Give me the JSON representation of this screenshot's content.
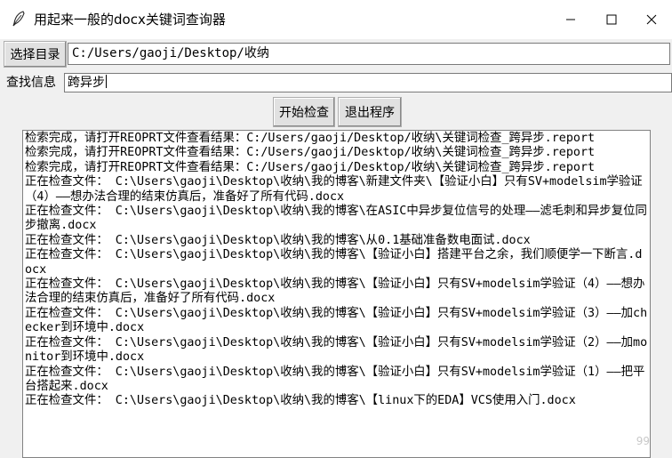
{
  "window": {
    "title": "用起来一般的docx关键词查询器",
    "minimize_icon": "minimize-icon",
    "maximize_icon": "maximize-icon",
    "close_icon": "close-icon"
  },
  "directory": {
    "button_label": "选择目录",
    "path_value": "C:/Users/gaoji/Desktop/收纳"
  },
  "search": {
    "label": "查找信息",
    "value": "跨异步"
  },
  "actions": {
    "start_label": "开始检查",
    "exit_label": "退出程序"
  },
  "log_lines": [
    "检索完成，请打开REOPRT文件查看结果：C:/Users/gaoji/Desktop/收纳\\关键词检查_跨异步.report",
    "检索完成，请打开REOPRT文件查看结果：C:/Users/gaoji/Desktop/收纳\\关键词检查_跨异步.report",
    "检索完成，请打开REOPRT文件查看结果：C:/Users/gaoji/Desktop/收纳\\关键词检查_跨异步.report",
    "正在检查文件： C:\\Users\\gaoji\\Desktop\\收纳\\我的博客\\新建文件夹\\【验证小白】只有SV+modelsim学验证（4）——想办法合理的结束仿真后，准备好了所有代码.docx",
    "正在检查文件： C:\\Users\\gaoji\\Desktop\\收纳\\我的博客\\在ASIC中异步复位信号的处理——滤毛刺和异步复位同步撤离.docx",
    "正在检查文件： C:\\Users\\gaoji\\Desktop\\收纳\\我的博客\\从0.1基础准备数电面试.docx",
    "正在检查文件： C:\\Users\\gaoji\\Desktop\\收纳\\我的博客\\【验证小白】搭建平台之余，我们顺便学一下断言.docx",
    "正在检查文件： C:\\Users\\gaoji\\Desktop\\收纳\\我的博客\\【验证小白】只有SV+modelsim学验证（4）——想办法合理的结束仿真后，准备好了所有代码.docx",
    "正在检查文件： C:\\Users\\gaoji\\Desktop\\收纳\\我的博客\\【验证小白】只有SV+modelsim学验证（3）——加checker到环境中.docx",
    "正在检查文件： C:\\Users\\gaoji\\Desktop\\收纳\\我的博客\\【验证小白】只有SV+modelsim学验证（2）——加monitor到环境中.docx",
    "正在检查文件： C:\\Users\\gaoji\\Desktop\\收纳\\我的博客\\【验证小白】只有SV+modelsim学验证（1）——把平台搭起来.docx",
    "正在检查文件： C:\\Users\\gaoji\\Desktop\\收纳\\我的博客\\【linux下的EDA】VCS使用入门.docx"
  ],
  "watermark": "99"
}
